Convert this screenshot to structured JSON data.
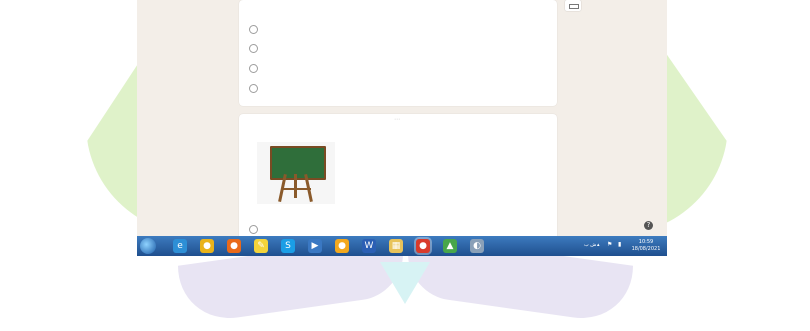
{
  "colors": {
    "watermark_green": "#dff2c9",
    "watermark_purple": "#e8e4f3",
    "watermark_cyan": "#d7f3f4",
    "page_background": "#f3eee8",
    "card_background": "#ffffff",
    "taskbar_blue": "#2a64a8",
    "chalkboard_green": "#2f6e3a"
  },
  "form": {
    "question1": {
      "options": [
        {
          "label": ""
        },
        {
          "label": ""
        },
        {
          "label": ""
        },
        {
          "label": ""
        }
      ]
    },
    "question2": {
      "title": "",
      "image_icon": "chalkboard-easel",
      "options": [
        {
          "label": ""
        }
      ]
    }
  },
  "sidebar": {
    "add_question_icon": "add-box-icon",
    "help_icon": "question-mark-icon"
  },
  "taskbar": {
    "start": "windows-start-orb",
    "apps": [
      {
        "name": "internet-explorer",
        "glyph": "e",
        "color": "#2d8fd6"
      },
      {
        "name": "chrome",
        "glyph": "●",
        "color": "#e9b31a"
      },
      {
        "name": "firefox",
        "glyph": "●",
        "color": "#e9691a"
      },
      {
        "name": "sticky-notes",
        "glyph": "✎",
        "color": "#f3d43b"
      },
      {
        "name": "skype",
        "glyph": "S",
        "color": "#1a9ee6"
      },
      {
        "name": "media-player",
        "glyph": "▶",
        "color": "#3a78c3"
      },
      {
        "name": "game",
        "glyph": "●",
        "color": "#f2a81d"
      },
      {
        "name": "word",
        "glyph": "W",
        "color": "#2b5fb4"
      },
      {
        "name": "file-explorer",
        "glyph": "▦",
        "color": "#e8c35a"
      },
      {
        "name": "chrome-active",
        "glyph": "●",
        "color": "#d93a2b",
        "active": true
      },
      {
        "name": "image-viewer",
        "glyph": "▲",
        "color": "#48a64a"
      },
      {
        "name": "unknown-app",
        "glyph": "◐",
        "color": "#8aa0b8"
      }
    ],
    "tray": {
      "language": "ش ب",
      "time": "10:59",
      "date": "18/08/2021"
    }
  }
}
